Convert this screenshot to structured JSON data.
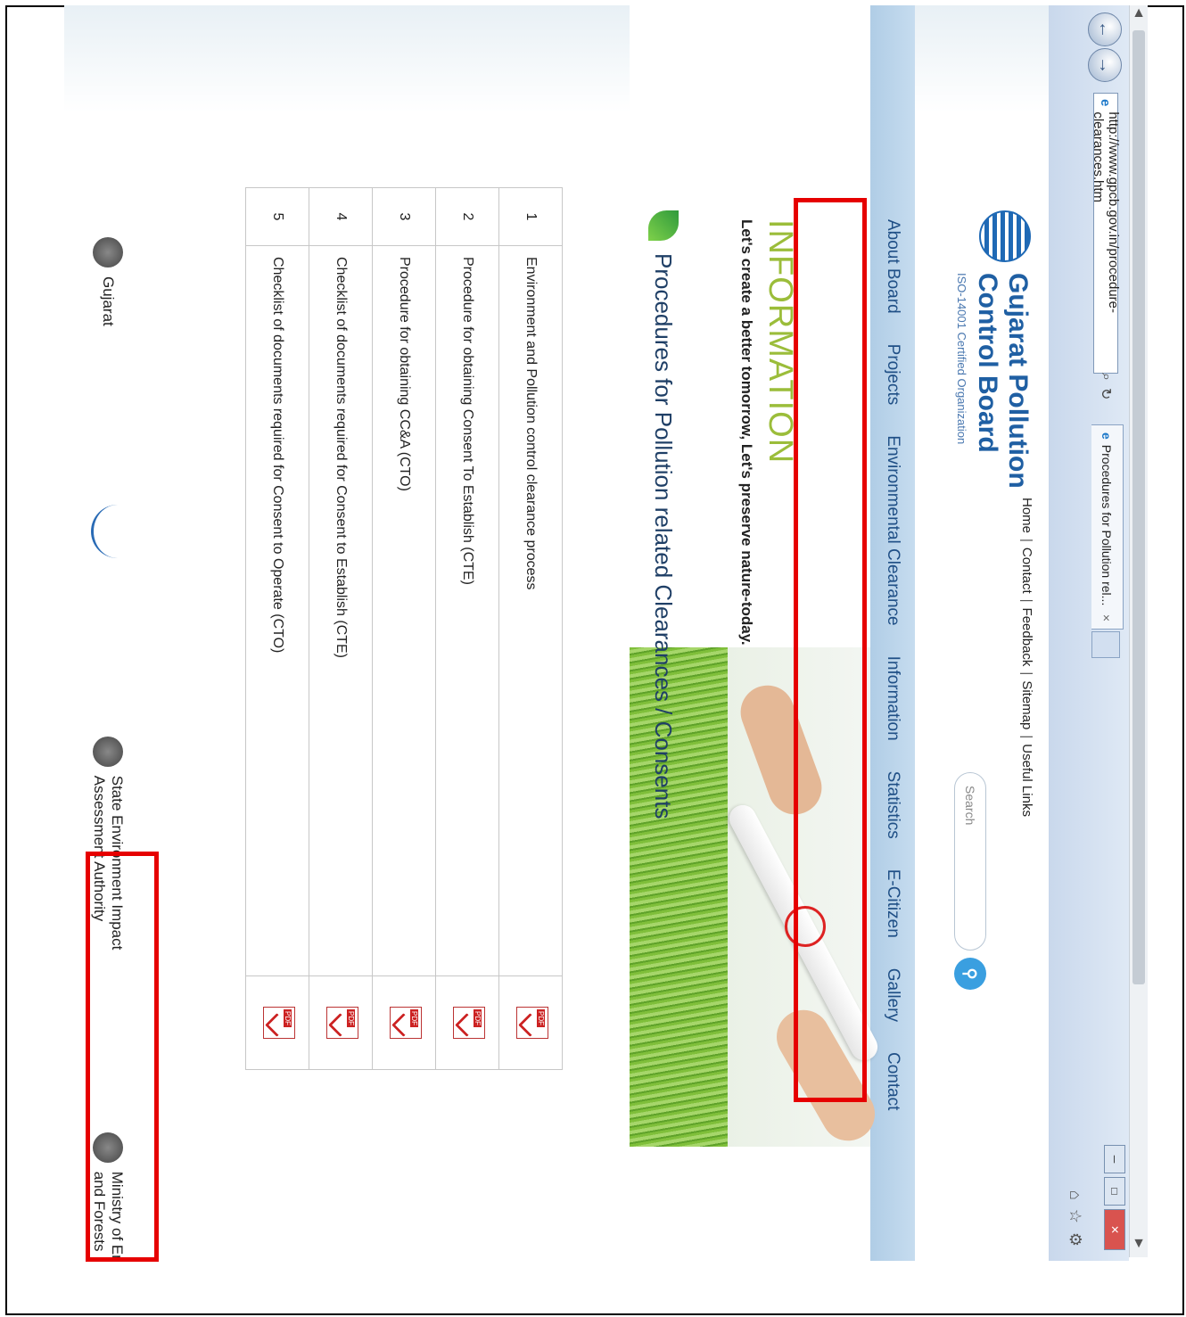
{
  "browser": {
    "address_url": "http://www.gpcb.gov.in/procedure-clearances.htm",
    "tab_title": "Procedures for Pollution rel...",
    "search_glyph": "⌕",
    "refresh_glyph": "↻",
    "tab_close": "×"
  },
  "site": {
    "brand_name": "Gujarat Pollution Control Board",
    "iso_text": "ISO-14001 Certified Organization",
    "top_links": [
      "Home",
      "Contact",
      "Feedback",
      "Sitemap",
      "Useful Links"
    ],
    "search_placeholder": "Search"
  },
  "menu": {
    "items": [
      "About Board",
      "Projects",
      "Environmental Clearance",
      "Information",
      "Statistics",
      "E-Citizen",
      "Gallery",
      "Contact"
    ]
  },
  "banner": {
    "heading": "INFORMATION",
    "subheading": "Let's create a better tomorrow, Let's preserve nature-today."
  },
  "section": {
    "title": "Procedures for Pollution related Clearances / Consents"
  },
  "table": {
    "rows": [
      {
        "num": "1",
        "text": "Environment and Pollution control clearance process"
      },
      {
        "num": "2",
        "text": "Procedure for obtaining Consent To Establish (CTE)"
      },
      {
        "num": "3",
        "text": "Procedure for obtaining CC&A (CTO)"
      },
      {
        "num": "4",
        "text": "Checklist of documents required for Consent to Establish (CTE)"
      },
      {
        "num": "5",
        "text": "Checklist of documents required for Consent to Operate (CTO)"
      }
    ]
  },
  "footer": {
    "items": [
      "Gujarat",
      "",
      "State Environment Impact Assessment Authority",
      "Ministry of Environment and Forests"
    ]
  },
  "colors": {
    "highlight": "#e60000",
    "brand": "#1f5fa3",
    "info_green": "#9bbd3a"
  }
}
